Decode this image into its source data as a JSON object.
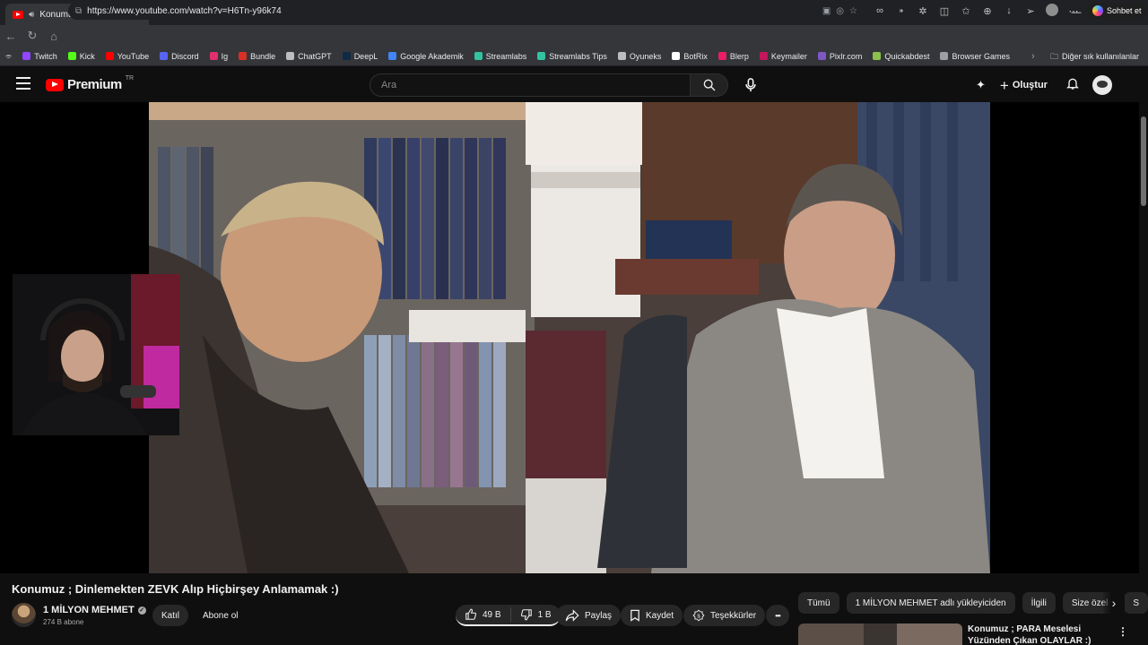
{
  "browser": {
    "tab_title": "Konumuz ; Dinlemekten ZEVK Alıp Hiçbirşey Anlamamak :)",
    "url": "https://www.youtube.com/watch?v=H6Tn-y96k74",
    "copilot_label": "Sohbet et",
    "bookmarks": [
      {
        "label": "Twitch",
        "color": "#9146ff"
      },
      {
        "label": "Kick",
        "color": "#53fc18"
      },
      {
        "label": "YouTube",
        "color": "#ff0000"
      },
      {
        "label": "Discord",
        "color": "#5865f2"
      },
      {
        "label": "Ig",
        "color": "#e1306c"
      },
      {
        "label": "Bundle",
        "color": "#d93025"
      },
      {
        "label": "ChatGPT",
        "color": "#bdbdbd"
      },
      {
        "label": "DeepL",
        "color": "#0f2b46"
      },
      {
        "label": "Google Akademik",
        "color": "#4285f4"
      },
      {
        "label": "Streamlabs",
        "color": "#31c3a2"
      },
      {
        "label": "Streamlabs Tips",
        "color": "#31c3a2"
      },
      {
        "label": "Oyuneks",
        "color": "#bdbdbd"
      },
      {
        "label": "BotRix",
        "color": "#ffffff"
      },
      {
        "label": "Blerp",
        "color": "#e91e63"
      },
      {
        "label": "Keymailer",
        "color": "#c2185b"
      },
      {
        "label": "Pixlr.com",
        "color": "#7e57c2"
      },
      {
        "label": "Quickabdest",
        "color": "#8bc34a"
      },
      {
        "label": "Browser Games",
        "color": "#9aa0a6"
      }
    ],
    "other_bookmarks": "Diğer sık kullanılanlar"
  },
  "youtube": {
    "logo_text": "Premium",
    "country_code": "TR",
    "search_placeholder": "Ara",
    "create_label": "Oluştur"
  },
  "video": {
    "title": "Konumuz ; Dinlemekten ZEVK Alıp Hiçbirşey Anlamamak :)",
    "channel": "1 MİLYON MEHMET",
    "subscribers": "274 B abone",
    "join_label": "Katıl",
    "subscribe_label": "Abone ol",
    "likes": "49 B",
    "dislikes": "1 B",
    "share_label": "Paylaş",
    "save_label": "Kaydet",
    "thanks_label": "Teşekkürler",
    "more_label": "•••"
  },
  "chips": [
    "Tümü",
    "1 MİLYON MEHMET adlı yükleyiciden",
    "İlgili",
    "Size özel",
    "S"
  ],
  "recommendation": {
    "title": "Konumuz ; PARA Meselesi Yüzünden Çıkan OLAYLAR :)"
  }
}
